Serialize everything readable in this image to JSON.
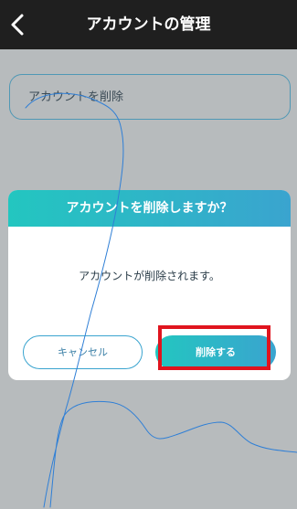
{
  "header": {
    "title": "アカウントの管理",
    "back_icon": "chevron-left-icon"
  },
  "menu": {
    "item_label": "アカウントを削除"
  },
  "dialog": {
    "title": "アカウントを削除しますか？",
    "message": "アカウントが削除されます。",
    "cancel_label": "キャンセル",
    "confirm_label": "削除する"
  },
  "colors": {
    "header_bg": "#1f1f1f",
    "overlay_bg": "#b7bbbd",
    "accent_start": "#23c6c0",
    "accent_end": "#3aa4cf",
    "highlight": "#e0141e",
    "scribble": "#2f7fd6"
  }
}
